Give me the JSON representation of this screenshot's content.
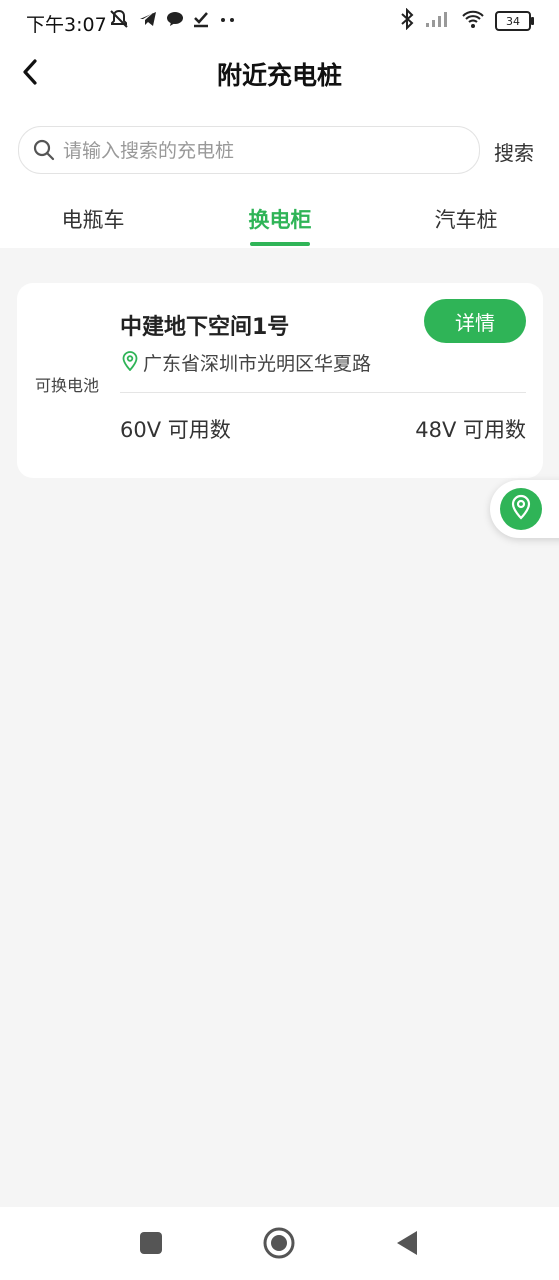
{
  "status_bar": {
    "time": "下午3:07",
    "battery": "34",
    "icons": [
      "mute-bell-icon",
      "telegram-icon",
      "chat-icon",
      "check-icon",
      "more-dots-icon",
      "bluetooth-icon",
      "signal-icon",
      "wifi-icon",
      "battery-icon"
    ]
  },
  "header": {
    "title": "附近充电桩"
  },
  "search": {
    "placeholder": "请输入搜索的充电桩",
    "button_label": "搜索"
  },
  "tabs": [
    {
      "label": "电瓶车",
      "active": false
    },
    {
      "label": "换电柜",
      "active": true
    },
    {
      "label": "汽车桩",
      "active": false
    }
  ],
  "card": {
    "side_label": "可换电池",
    "name": "中建地下空间1号",
    "details_label": "详情",
    "address": "广东省深圳市光明区华夏路",
    "left_stat": "60V 可用数",
    "right_stat": "48V 可用数"
  },
  "colors": {
    "accent": "#2fb457",
    "background": "#f5f5f5"
  }
}
